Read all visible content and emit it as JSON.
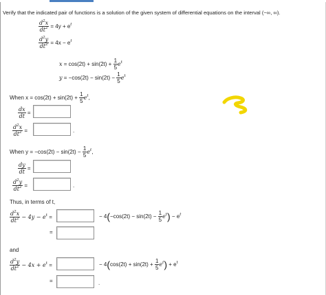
{
  "header": {
    "instruction": "Verify that the indicated pair of functions is a solution of the given system of differential equations on the interval (−∞, ∞)."
  },
  "system": {
    "eq1_rhs": "= 4y + e",
    "eq2_rhs": "= 4x − e",
    "exp_t": "t"
  },
  "solutions": {
    "x_lhs": "x",
    "x_rhs": "= cos(2t) + sin(2t) +",
    "y_lhs": "y",
    "y_rhs": "= −cos(2t) − sin(2t) −",
    "fifth_num": "1",
    "fifth_den": "5",
    "e": "e",
    "t": "t"
  },
  "part_x": {
    "lead": "When x = cos(2t) + sin(2t) +",
    "trail": ",",
    "dxdt_num": "dx",
    "dxdt_den": "dt",
    "d2x_num": "d",
    "d2x_den": "dt",
    "eq": "=",
    "period": "."
  },
  "part_y": {
    "lead": "When y = −cos(2t) − sin(2t) −",
    "trail": ",",
    "dydt_num": "dy",
    "dydt_den": "dt",
    "d2y_num": "d",
    "d2y_den": "dt",
    "eq": "=",
    "period": "."
  },
  "verify_x": {
    "intro": "Thus, in terms of t,",
    "minus_4y": "− 4y − e",
    "eq": "=",
    "rhs_lead": "− 4",
    "rhs_inner": "−cos(2t) − sin(2t) −",
    "rhs_tail": "− e",
    "eq2": "="
  },
  "verify_y": {
    "and": "and",
    "minus_4x": "− 4x + e",
    "eq": "=",
    "rhs_lead": "− 4",
    "rhs_inner": "cos(2t) + sin(2t) +",
    "rhs_tail": "+ e",
    "eq2": "=",
    "period": "."
  },
  "annotation": {
    "color": "#f2d600",
    "icon": "yellow-handwritten-mark"
  },
  "colors": {
    "header_bar": "#4a7fc1",
    "input_border": "#8e8e8e"
  }
}
